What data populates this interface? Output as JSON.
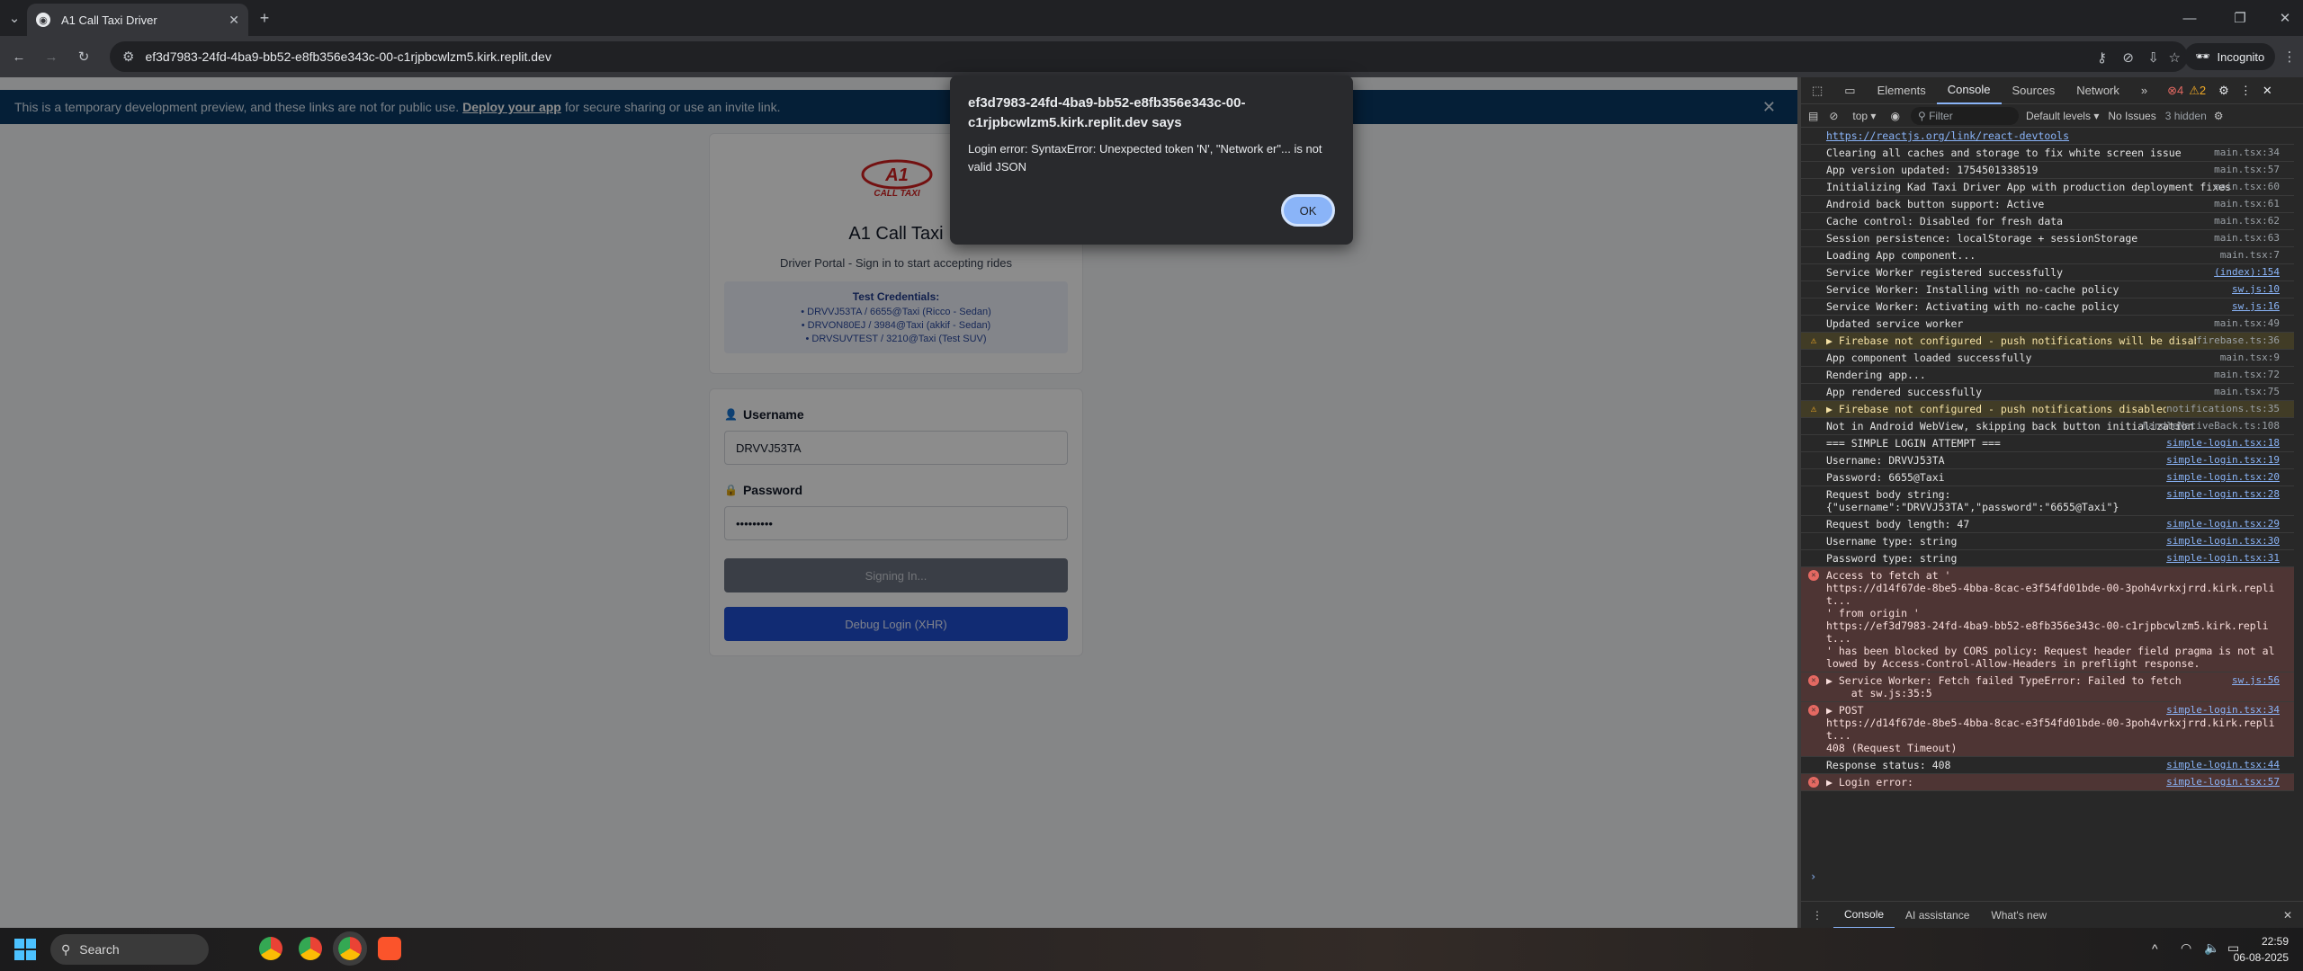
{
  "browser": {
    "tab_title": "A1 Call Taxi Driver",
    "url": "ef3d7983-24fd-4ba9-bb52-e8fb356e343c-00-c1rjpbcwlzm5.kirk.replit.dev",
    "incognito_label": "Incognito"
  },
  "banner": {
    "text_before": "This is a temporary development preview, and these links are not for public use.",
    "link": "Deploy your app",
    "text_after": "for secure sharing or use an invite link."
  },
  "app": {
    "logo_text": "A1",
    "logo_sub": "CALL TAXI",
    "title": "A1 Call Taxi",
    "subtitle": "Driver Portal - Sign in to start accepting rides",
    "cred_title": "Test Credentials:",
    "credentials": [
      "• DRVVJ53TA / 6655@Taxi (Ricco - Sedan)",
      "• DRVON80EJ / 3984@Taxi (akkif - Sedan)",
      "• DRVSUVTEST / 3210@Taxi (Test SUV)"
    ],
    "username_label": "Username",
    "username_value": "DRVVJ53TA",
    "password_label": "Password",
    "password_value": "•••••••••",
    "signin_label": "Signing In...",
    "debug_label": "Debug Login (XHR)"
  },
  "dialog": {
    "title": "ef3d7983-24fd-4ba9-bb52-e8fb356e343c-00-c1rjpbcwlzm5.kirk.replit.dev says",
    "message": "Login error: SyntaxError: Unexpected token 'N', \"Network er\"... is not valid JSON",
    "ok": "OK"
  },
  "devtools": {
    "tabs": [
      "Elements",
      "Console",
      "Sources",
      "Network"
    ],
    "active_tab": "Console",
    "error_count": "4",
    "warning_count": "2",
    "context": "top",
    "filter_placeholder": "Filter",
    "levels": "Default levels",
    "issues": "No Issues",
    "hidden": "3 hidden",
    "drawer_tabs": [
      "Console",
      "AI assistance",
      "What's new"
    ],
    "logs": [
      {
        "level": "info",
        "text": "https://reactjs.org/link/react-devtools",
        "src": ""
      },
      {
        "level": "info",
        "text": "Clearing all caches and storage to fix white screen issue",
        "src": "main.tsx:34"
      },
      {
        "level": "info",
        "text": "App version updated: 1754501338519",
        "src": "main.tsx:57"
      },
      {
        "level": "info",
        "text": "Initializing Kad Taxi Driver App with production deployment fixes",
        "src": "main.tsx:60"
      },
      {
        "level": "info",
        "text": "Android back button support: Active",
        "src": "main.tsx:61"
      },
      {
        "level": "info",
        "text": "Cache control: Disabled for fresh data",
        "src": "main.tsx:62"
      },
      {
        "level": "info",
        "text": "Session persistence: localStorage + sessionStorage",
        "src": "main.tsx:63"
      },
      {
        "level": "info",
        "text": "Loading App component...",
        "src": "main.tsx:7"
      },
      {
        "level": "info",
        "text": "Service Worker registered successfully",
        "src": "(index):154",
        "link": true
      },
      {
        "level": "info",
        "text": "Service Worker: Installing with no-cache policy",
        "src": "sw.js:10",
        "link": true
      },
      {
        "level": "info",
        "text": "Service Worker: Activating with no-cache policy",
        "src": "sw.js:16",
        "link": true
      },
      {
        "level": "info",
        "text": "Updated service worker",
        "src": "main.tsx:49"
      },
      {
        "level": "warn",
        "text": "▶ Firebase not configured - push notifications will be disabled",
        "src": "firebase.ts:36"
      },
      {
        "level": "info",
        "text": "App component loaded successfully",
        "src": "main.tsx:9"
      },
      {
        "level": "info",
        "text": "Rendering app...",
        "src": "main.tsx:72"
      },
      {
        "level": "info",
        "text": "App rendered successfully",
        "src": "main.tsx:75"
      },
      {
        "level": "warn",
        "text": "▶ Firebase not configured - push notifications disabled",
        "src": "notifications.ts:35"
      },
      {
        "level": "info",
        "text": "Not in Android WebView, skipping back button initialization",
        "src": "handleNativeBack.ts:108"
      },
      {
        "level": "info",
        "text": "=== SIMPLE LOGIN ATTEMPT ===",
        "src": "simple-login.tsx:18",
        "link": true
      },
      {
        "level": "info",
        "text": "Username: DRVVJ53TA",
        "src": "simple-login.tsx:19",
        "link": true
      },
      {
        "level": "info",
        "text": "Password: 6655@Taxi",
        "src": "simple-login.tsx:20",
        "link": true
      },
      {
        "level": "info",
        "text": "Request body string:\n{\"username\":\"DRVVJ53TA\",\"password\":\"6655@Taxi\"}",
        "src": "simple-login.tsx:28",
        "link": true
      },
      {
        "level": "info",
        "text": "Request body length: 47",
        "src": "simple-login.tsx:29",
        "link": true
      },
      {
        "level": "info",
        "text": "Username type: string",
        "src": "simple-login.tsx:30",
        "link": true
      },
      {
        "level": "info",
        "text": "Password type: string",
        "src": "simple-login.tsx:31",
        "link": true
      },
      {
        "level": "err",
        "text": "Access to fetch at '\nhttps://d14f67de-8be5-4bba-8cac-e3f54fd01bde-00-3poh4vrkxjrrd.kirk.replit...\n' from origin '\nhttps://ef3d7983-24fd-4ba9-bb52-e8fb356e343c-00-c1rjpbcwlzm5.kirk.replit...\n' has been blocked by CORS policy: Request header field pragma is not allowed by Access-Control-Allow-Headers in preflight response.",
        "src": ""
      },
      {
        "level": "err",
        "text": "▶ Service Worker: Fetch failed TypeError: Failed to fetch\n    at sw.js:35:5",
        "src": "sw.js:56",
        "link": true
      },
      {
        "level": "err",
        "text": "▶ POST\nhttps://d14f67de-8be5-4bba-8cac-e3f54fd01bde-00-3poh4vrkxjrrd.kirk.replit...\n408 (Request Timeout)",
        "src": "simple-login.tsx:34",
        "link": true
      },
      {
        "level": "info",
        "text": "Response status: 408",
        "src": "simple-login.tsx:44",
        "link": true
      },
      {
        "level": "err",
        "text": "▶ Login error:",
        "src": "simple-login.tsx:57",
        "link": true
      }
    ]
  },
  "taskbar": {
    "search": "Search",
    "time": "22:59",
    "date": "06-08-2025"
  }
}
